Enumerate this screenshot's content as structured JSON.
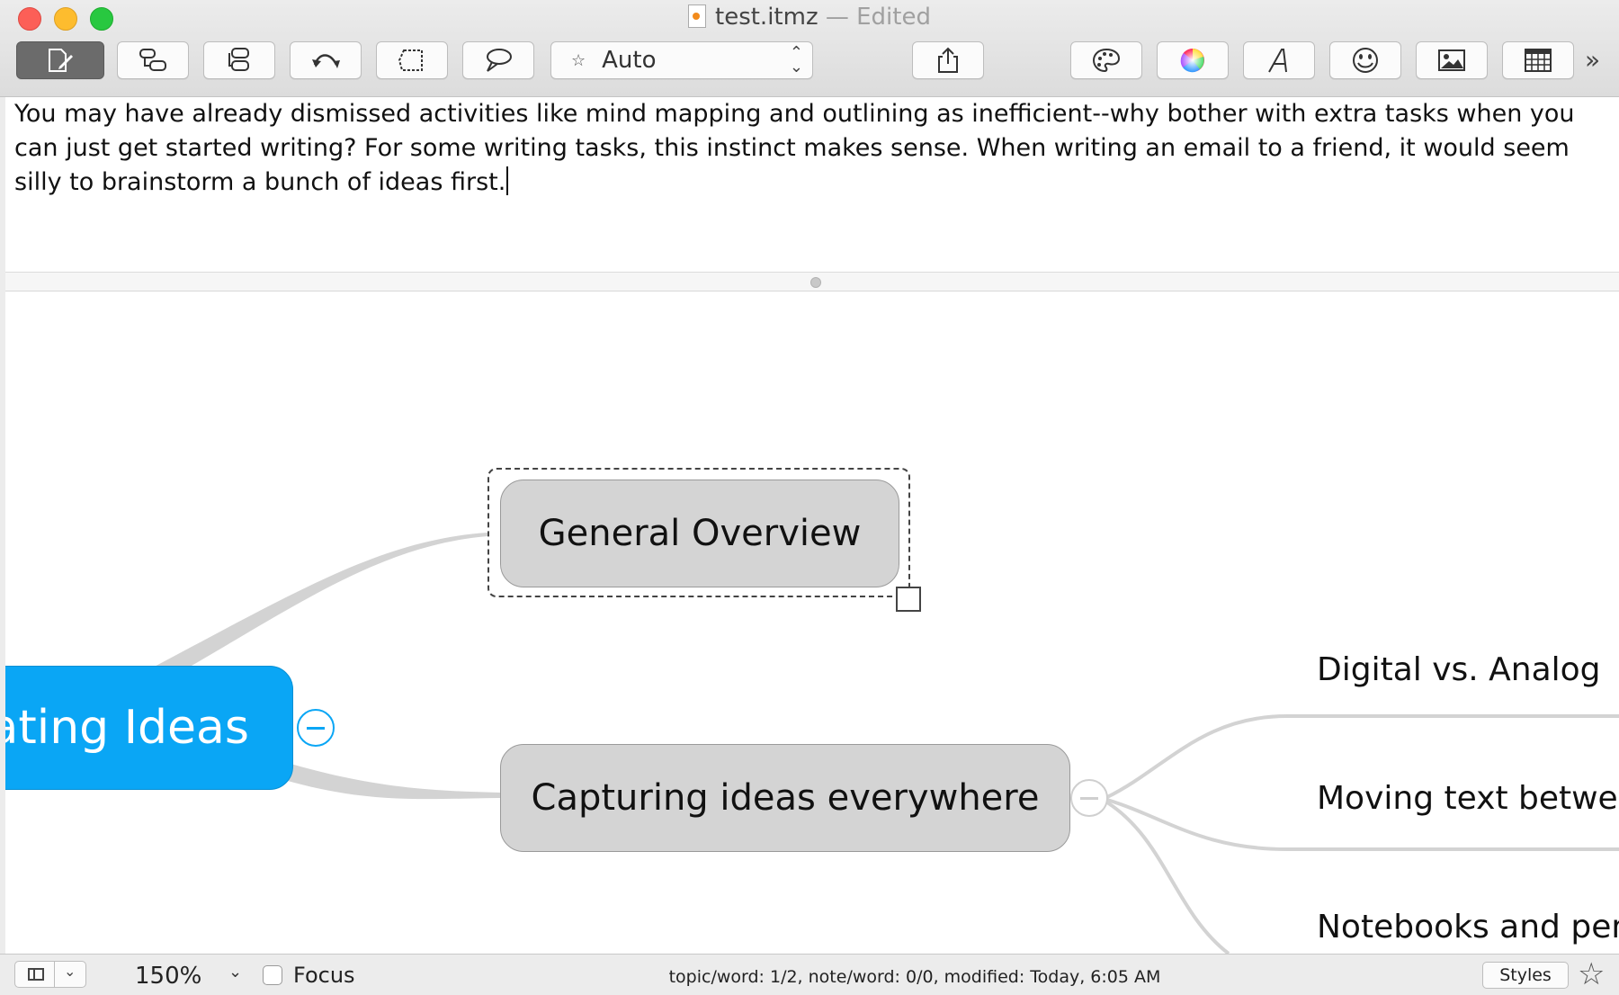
{
  "window": {
    "title": "test.itmz",
    "status_suffix": " — Edited"
  },
  "toolbar": {
    "mode_select_value": "Auto",
    "overflow_label": "»"
  },
  "note": {
    "text": "You may have already dismissed activities like mind mapping and outlining as inefficient--why bother with extra tasks when you can just get started writing? For some writing tasks, this instinct makes sense. When writing an email to a friend, it would seem silly to brainstorm a bunch of ideas first."
  },
  "map": {
    "central_topic": "ating Ideas",
    "topics": [
      {
        "label": "General Overview",
        "selected": true
      },
      {
        "label": "Capturing ideas everywhere",
        "selected": false
      }
    ],
    "subtopics": [
      {
        "label": "Digital vs. Analog"
      },
      {
        "label": "Moving text betweer"
      },
      {
        "label": "Notebooks and pens"
      }
    ],
    "colors": {
      "central_fill": "#0aa6f5",
      "topic_fill": "#d4d4d4",
      "branch": "#d3d3d3"
    }
  },
  "statusbar": {
    "zoom": "150%",
    "focus_label": "Focus",
    "stats": "topic/word: 1/2, note/word: 0/0, modified: Today, 6:05 AM",
    "styles_label": "Styles",
    "star": "☆"
  }
}
